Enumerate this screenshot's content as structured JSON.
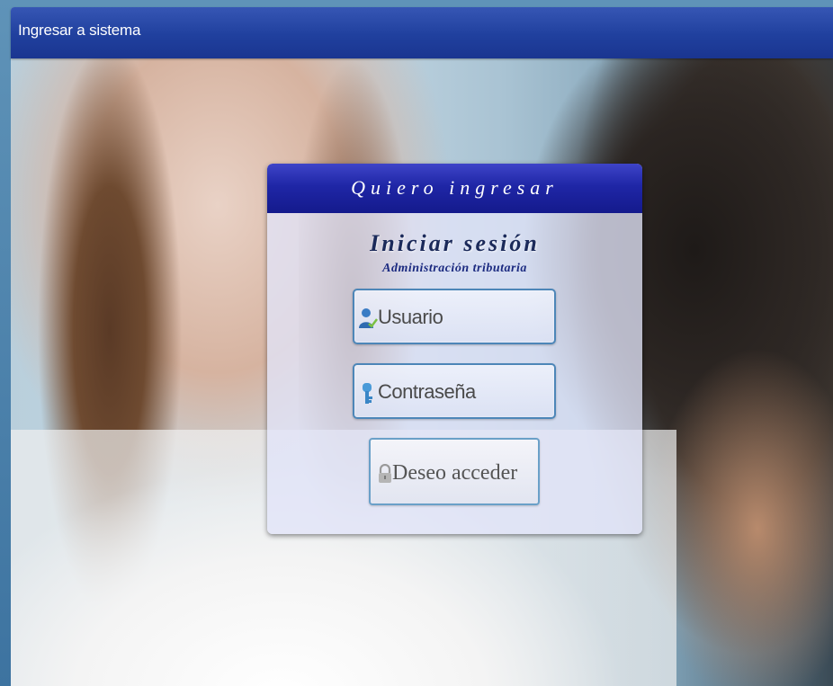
{
  "window": {
    "title": "Ingresar a sistema"
  },
  "login_panel": {
    "header": "Quiero ingresar",
    "heading": "Iniciar sesión",
    "subheading": "Administración tributaria",
    "username_placeholder": "Usuario",
    "password_placeholder": "Contraseña",
    "submit_label": "Deseo acceder",
    "icons": {
      "username": "user-icon",
      "password": "key-icon",
      "submit": "padlock-icon"
    }
  },
  "colors": {
    "titlebar": "#20409e",
    "panel_header": "#1f26a6",
    "field_border": "#4d86b8"
  }
}
